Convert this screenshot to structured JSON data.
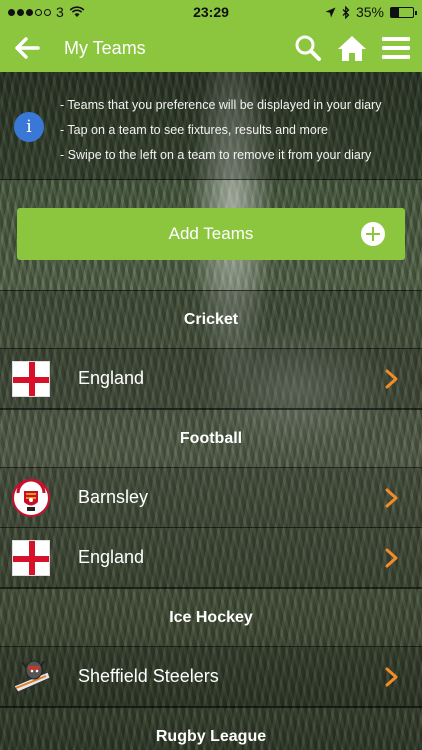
{
  "status": {
    "carrier": "3",
    "time": "23:29",
    "battery": "35%",
    "signal_total": 5,
    "signal_full": 3,
    "battery_level": 0.35
  },
  "nav": {
    "title": "My Teams"
  },
  "info": {
    "lines": [
      "- Teams that you preference will be displayed in your diary",
      "- Tap on a team to see fixtures, results and more",
      "- Swipe to the left on a team to remove it from your diary"
    ]
  },
  "add_button": {
    "label": "Add Teams"
  },
  "sections": [
    {
      "name": "Cricket",
      "teams": [
        {
          "name": "England",
          "logo": "england-flag"
        }
      ]
    },
    {
      "name": "Football",
      "teams": [
        {
          "name": "Barnsley",
          "logo": "barnsley-crest"
        },
        {
          "name": "England",
          "logo": "england-flag"
        }
      ]
    },
    {
      "name": "Ice Hockey",
      "teams": [
        {
          "name": "Sheffield Steelers",
          "logo": "sheffield-steelers-logo"
        }
      ]
    },
    {
      "name": "Rugby League",
      "teams": []
    }
  ],
  "colors": {
    "accent": "#8cc63f",
    "chevron": "#f28c28",
    "info_icon": "#3a78d8",
    "england_red": "#d8112b"
  }
}
